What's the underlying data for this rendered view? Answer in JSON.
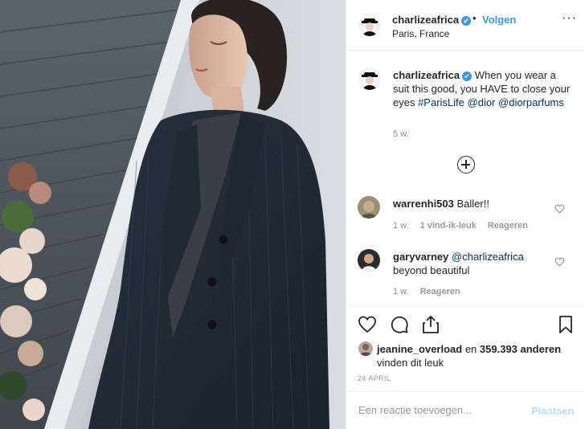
{
  "post": {
    "author": "charlizeafrica",
    "verified_mark": "✔",
    "separator": "•",
    "follow_label": "Volgen",
    "location": "Paris, France",
    "more_label": "···",
    "image_alt": "Woman in a dark pinstripe suit with eyes closed"
  },
  "caption": {
    "author": "charlizeafrica",
    "text_before": " When you wear a suit this good, you HAVE to close your eyes ",
    "hashtag": "#ParisLife",
    "mention1": "@dior",
    "mention2": "@diorparfums",
    "time": "5 w."
  },
  "comments": [
    {
      "user": "warrenhi503",
      "text": " Baller!!",
      "time": "1 w.",
      "likes": "1 vind-ik-leuk",
      "reply": "Reageren"
    },
    {
      "user": "garyvarney",
      "mention": "@charlizeafrica",
      "text": "beyond beautiful",
      "time": "1 w.",
      "reply": "Reageren"
    }
  ],
  "actions": {
    "like_icon": "heart-icon",
    "comment_icon": "comment-icon",
    "share_icon": "share-icon",
    "save_icon": "bookmark-icon"
  },
  "likes": {
    "user": "jeanine_overload",
    "connector": " en ",
    "count": "359.393 anderen",
    "suffix": "vinden dit leuk"
  },
  "date": "24 april",
  "add_comment": {
    "placeholder": "Een reactie toevoegen...",
    "submit_label": "Plaatsen"
  },
  "colors": {
    "accent": "#3897f0",
    "link": "#003569",
    "muted": "#8e8e8e",
    "disabled_submit": "#b2dffc"
  }
}
